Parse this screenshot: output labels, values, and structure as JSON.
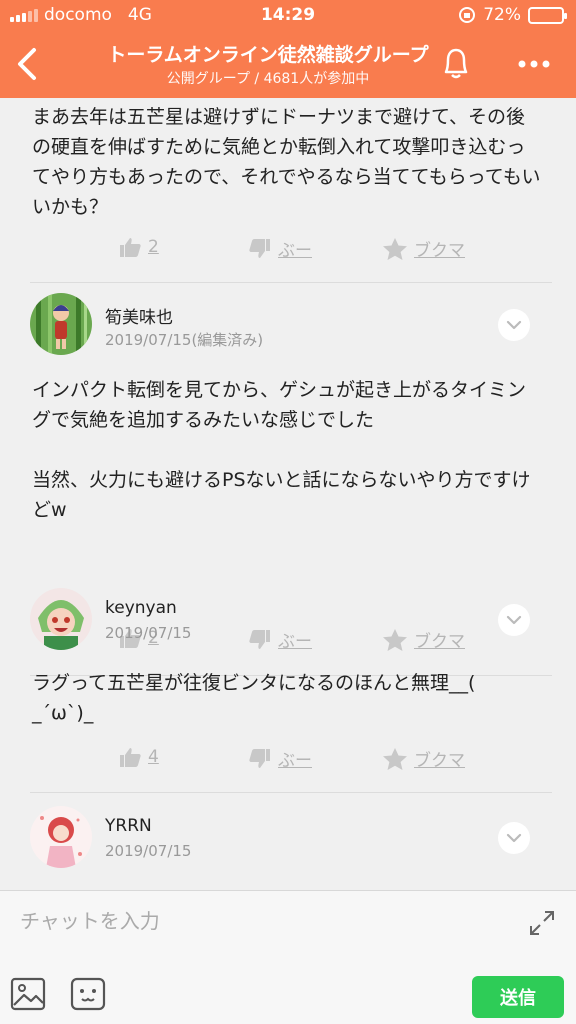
{
  "status": {
    "carrier": "docomo",
    "network": "4G",
    "time": "14:29",
    "battery": "72%",
    "battery_level": 0.72
  },
  "header": {
    "title": "トーラムオンライン徒然雑談グループ",
    "subtitle": "公開グループ / 4681人が参加中"
  },
  "posts": [
    {
      "body": "まあ去年は五芒星は避けずにドーナツまで避けて、その後の硬直を伸ばすために気絶とか転倒入れて攻撃叩き込むってやり方もあったので、それでやるなら当ててもらってもいいかも？",
      "like_count": "2",
      "dislike_label": "ぶー",
      "bookmark_label": "ブクマ"
    },
    {
      "author": "筍美味也",
      "date": "2019/07/15(編集済み)",
      "body": "インパクト転倒を見てから、ゲシュが起き上がるタイミングで気絶を追加するみたいな感じでした\n\n当然、火力にも避けるPSないと話にならないやり方ですけどw",
      "like_count": "2",
      "dislike_label": "ぶー",
      "bookmark_label": "ブクマ"
    },
    {
      "author": "keynyan",
      "date": "2019/07/15",
      "body": "ラグって五芒星が往復ビンタになるのほんと無理__(\n_´ω`)_",
      "like_count": "4",
      "dislike_label": "ぶー",
      "bookmark_label": "ブクマ"
    },
    {
      "author": "YRRN",
      "date": "2019/07/15"
    }
  ],
  "composer": {
    "placeholder": "チャットを入力",
    "send_label": "送信"
  },
  "colors": {
    "brand": "#f97c4e",
    "send": "#2ecc57"
  }
}
